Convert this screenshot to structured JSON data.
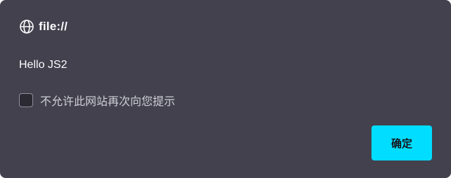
{
  "dialog": {
    "origin": "file://",
    "origin_icon": "globe-icon",
    "message": "Hello JS2",
    "checkbox_label": "不允许此网站再次向您提示",
    "checkbox_checked": false,
    "ok_label": "确定"
  },
  "colors": {
    "dialog_background": "#42414d",
    "accent": "#00ddff",
    "text": "#fbfbfe"
  }
}
